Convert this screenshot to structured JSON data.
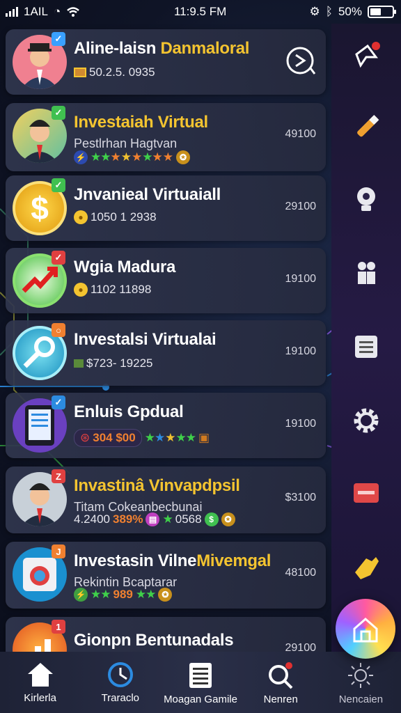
{
  "status_bar": {
    "carrier": "1AIL",
    "time": "11:9.5 FM",
    "battery": "50%",
    "battery_level": 0.5
  },
  "list": [
    {
      "title": "Aline-laisn Danmaloral",
      "title_color": "#ffffff",
      "title_accent": "Danmaloral",
      "line1": "50.2.5. 0935",
      "badge_color": "#3aa0ff",
      "badge": "✓",
      "has_action": true
    },
    {
      "title": "Investaiah Virtual",
      "title_color": "#f4c430",
      "subtitle": "Pestlrhan Hagtvan",
      "value": "49100",
      "badge_color": "#40c050",
      "badge": "✓"
    },
    {
      "title": "Jnvanieal Virtuaiall",
      "title_color": "#ffffff",
      "line1": "1050 1 2938",
      "value": "29100",
      "badge_color": "#40c050",
      "badge": "✓"
    },
    {
      "title": "Wgia Madura",
      "title_color": "#ffffff",
      "line1": "1102 11898",
      "value": "19100",
      "badge_color": "#e04040",
      "badge": "✓"
    },
    {
      "title": "Investalsi Virtualai",
      "title_color": "#ffffff",
      "line1": "$723- 19225",
      "value": "19100",
      "badge_color": "#f08030",
      "badge": "○"
    },
    {
      "title": "Enluis Gpdual",
      "title_color": "#ffffff",
      "line1": "304 $00",
      "value": "19100",
      "badge_color": "#2c8be0",
      "badge": "✓"
    },
    {
      "title": "Invastinâ Vinvapdpsil",
      "title_color": "#f4c430",
      "subtitle": "Titam Cokeanbecbunai",
      "line1a": "4.2400",
      "line1b": "389%",
      "line1c": "0568",
      "value": "$3100",
      "badge_color": "#e04040",
      "badge": "Z"
    },
    {
      "title_a": "Investasin Vilne",
      "title_b": "Mivemgal",
      "subtitle": "Rekintin Bcaptarar",
      "line1": "989",
      "value": "48100",
      "badge_color": "#f08030",
      "badge": "J"
    },
    {
      "title": "Gionpn Bentunadals",
      "title_color": "#ffffff",
      "value": "29100",
      "badge_color": "#e04040",
      "badge": "1"
    }
  ],
  "rail": {
    "icons": [
      "pin-notification-icon",
      "pencil-icon",
      "lightbulb-gear-icon",
      "people-icon",
      "document-icon",
      "settings-gear-icon",
      "card-icon",
      "hand-icon"
    ]
  },
  "bottom_nav": [
    {
      "label": "Kirlerla",
      "icon": "home-icon"
    },
    {
      "label": "Traraclo",
      "icon": "clock-icon"
    },
    {
      "label": "Moagan Gamile",
      "icon": "list-icon"
    },
    {
      "label": "Nenren",
      "icon": "search-icon"
    },
    {
      "label": "Nencaien",
      "icon": "sun-icon"
    }
  ],
  "colors": {
    "accent_yellow": "#f4c430",
    "star_green": "#3fd04a",
    "background": "#0f1426",
    "rail": "#251a44"
  }
}
